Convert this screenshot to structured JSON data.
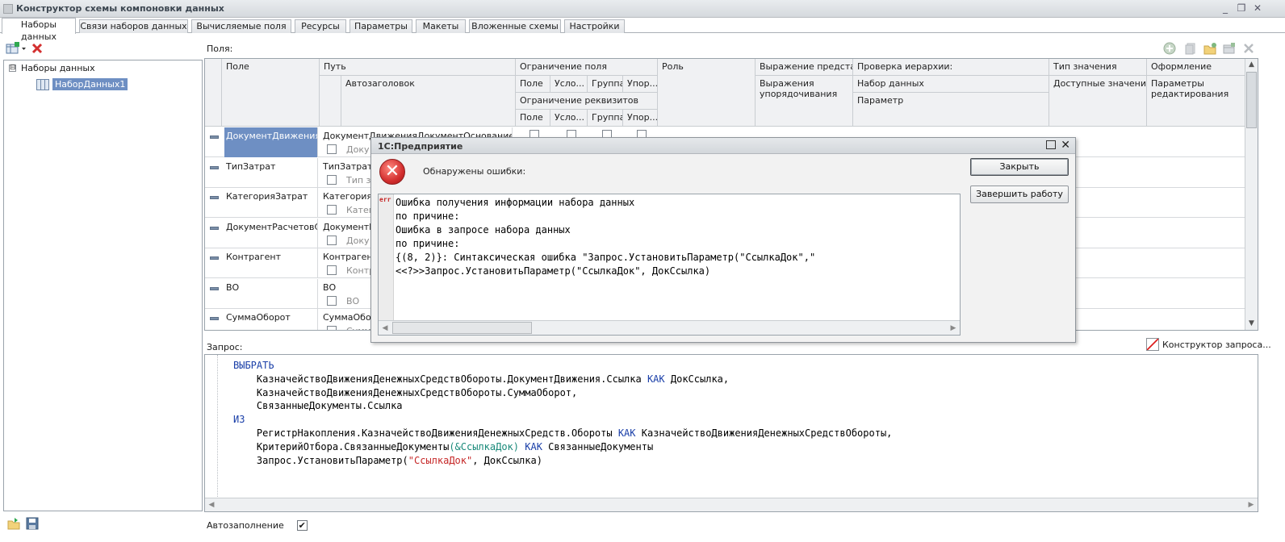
{
  "window": {
    "title": "Конструктор схемы компоновки данных"
  },
  "tabs": [
    {
      "label": "Наборы данных"
    },
    {
      "label": "Связи наборов данных"
    },
    {
      "label": "Вычисляемые поля"
    },
    {
      "label": "Ресурсы"
    },
    {
      "label": "Параметры"
    },
    {
      "label": "Макеты"
    },
    {
      "label": "Вложенные схемы"
    },
    {
      "label": "Настройки"
    }
  ],
  "tree": {
    "root_label": "Наборы данных",
    "child_label": "НаборДанных1",
    "expander": "⊟"
  },
  "fields": {
    "label": "Поля:",
    "headers": {
      "field": "Поле",
      "path": "Путь",
      "autotitle": "Автозаголовок",
      "restriction": "Ограничение поля",
      "r_field": "Поле",
      "r_cond": "Усло...",
      "r_group": "Группа",
      "r_order": "Упор...",
      "req_restriction": "Ограничение реквизитов",
      "q_field": "Поле",
      "q_cond": "Усло...",
      "q_group": "Группа",
      "q_order": "Упор...",
      "role": "Роль",
      "expr_present": "Выражение предста...",
      "expr_order": "Выражения упорядочивания",
      "hier_check": "Проверка иерархии:",
      "dataset": "Набор данных",
      "param": "Параметр",
      "value_type": "Тип значения",
      "avail_values": "Доступные значения",
      "appearance": "Оформление",
      "edit_params": "Параметры редактирования"
    },
    "rows": [
      {
        "name": "ДокументДвижения...",
        "path": "ДокументДвиженияДокументОснованиеСс",
        "auto": "Доку"
      },
      {
        "name": "ТипЗатрат",
        "path": "ТипЗатрат",
        "auto": "Тип з"
      },
      {
        "name": "КатегорияЗатрат",
        "path": "КатегорияЗ",
        "auto": "Катег"
      },
      {
        "name": "ДокументРасчетовС...",
        "path": "ДокументР",
        "auto": "Доку"
      },
      {
        "name": "Контрагент",
        "path": "Контрагент",
        "auto": "Контр"
      },
      {
        "name": "ВО",
        "path": "ВО",
        "auto": "ВО"
      },
      {
        "name": "СуммаОборот",
        "path": "СуммаОборо",
        "auto": "Сумм"
      }
    ]
  },
  "query": {
    "label": "Запрос:",
    "builder_label": "Конструктор запроса...",
    "lines": [
      [
        {
          "t": "ВЫБРАТЬ",
          "c": "kw"
        }
      ],
      [
        {
          "t": "    КазначействоДвиженияДенежныхСредствОбороты.ДокументДвижения.Ссылка ",
          "c": ""
        },
        {
          "t": "КАК",
          "c": "kw"
        },
        {
          "t": " ДокСсылка,",
          "c": ""
        }
      ],
      [
        {
          "t": "    КазначействоДвиженияДенежныхСредствОбороты.СуммаОборот,",
          "c": ""
        }
      ],
      [
        {
          "t": "    СвязанныеДокументы.Ссылка",
          "c": ""
        }
      ],
      [
        {
          "t": "ИЗ",
          "c": "kw"
        }
      ],
      [
        {
          "t": "    РегистрНакопления.КазначействоДвиженияДенежныхСредств.Обороты ",
          "c": ""
        },
        {
          "t": "КАК",
          "c": "kw"
        },
        {
          "t": " КазначействоДвиженияДенежныхСредствОбороты,",
          "c": ""
        }
      ],
      [
        {
          "t": "    КритерийОтбора.СвязанныеДокументы",
          "c": ""
        },
        {
          "t": "(&СсылкаДок)",
          "c": "par"
        },
        {
          "t": " ",
          "c": ""
        },
        {
          "t": "КАК",
          "c": "kw"
        },
        {
          "t": " СвязанныеДокументы",
          "c": ""
        }
      ],
      [
        {
          "t": "    Запрос.УстановитьПараметр(",
          "c": ""
        },
        {
          "t": "\"СсылкаДок\"",
          "c": "str"
        },
        {
          "t": ", ДокСсылка)",
          "c": ""
        }
      ]
    ]
  },
  "autofill": {
    "label": "Автозаполнение",
    "checked": true,
    "mark": "✔"
  },
  "dialog": {
    "title": "1С:Предприятие",
    "message": "Обнаружены ошибки:",
    "close_button": "Закрыть",
    "exit_button": "Завершить работу",
    "err_tag": "err",
    "error_icon_glyph": "✕",
    "text_lines": [
      "Ошибка получения информации набора данных",
      "по причине:",
      "Ошибка в запросе набора данных",
      "по причине:",
      "{(8, 2)}: Синтаксическая ошибка \"Запрос.УстановитьПараметр(\"СсылкаДок\",\"",
      "<<?>>Запрос.УстановитьПараметр(\"СсылкаДок\", ДокСсылка)"
    ]
  },
  "icons": {
    "add_dataset": "add-dataset-icon",
    "delete": "delete-icon",
    "grid_add": "add-field-icon",
    "grid_copy": "copy-icon",
    "grid_folder": "add-folder-icon",
    "grid_table": "add-table-icon",
    "grid_delete": "delete-field-icon",
    "folder_open": "open-icon",
    "save": "save-icon"
  },
  "colors": {
    "selection": "#6e8fc3",
    "keyword": "#1a3fa8",
    "string": "#c62828",
    "param": "#1a8a7a",
    "error": "#d32f2f"
  }
}
